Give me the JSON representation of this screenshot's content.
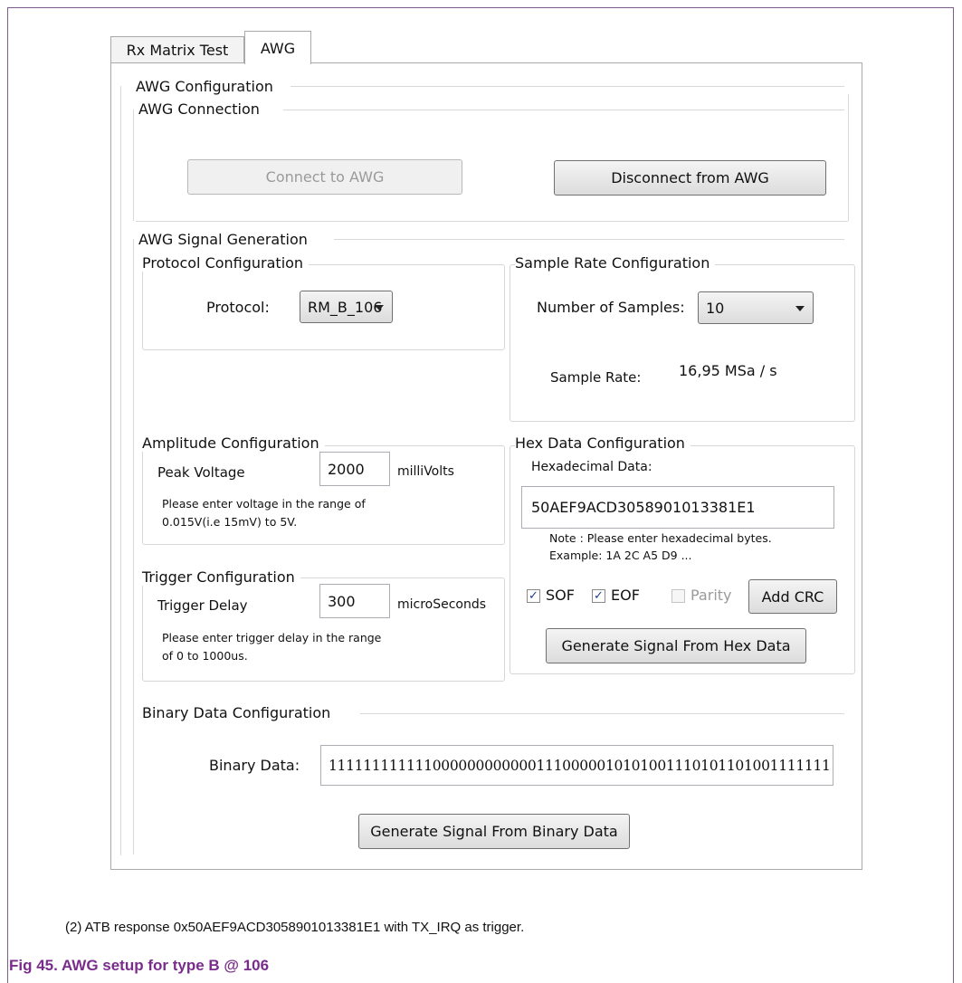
{
  "tabs": [
    {
      "label": "Rx Matrix Test"
    },
    {
      "label": "AWG"
    }
  ],
  "awg_config": {
    "title": "AWG Configuration",
    "connection": {
      "title": "AWG Connection",
      "connect_label": "Connect to AWG",
      "disconnect_label": "Disconnect from AWG"
    },
    "signal_generation": {
      "title": "AWG Signal Generation",
      "protocol": {
        "title": "Protocol Configuration",
        "label": "Protocol:",
        "value": "RM_B_106"
      },
      "sample_rate": {
        "title": "Sample Rate Configuration",
        "num_samples_label": "Number of Samples:",
        "num_samples_value": "10",
        "rate_label": "Sample Rate:",
        "rate_value": "16,95 MSa / s"
      },
      "amplitude": {
        "title": "Amplitude Configuration",
        "label": "Peak Voltage",
        "value": "2000",
        "unit": "milliVolts",
        "note": "Please enter voltage in the range of 0.015V(i.e 15mV) to 5V."
      },
      "trigger": {
        "title": "Trigger Configuration",
        "label": "Trigger Delay",
        "value": "300",
        "unit": "microSeconds",
        "note": "Please enter trigger delay in the range of 0 to 1000us."
      },
      "hex": {
        "title": "Hex Data Configuration",
        "label": "Hexadecimal Data:",
        "value": "50AEF9ACD3058901013381E1",
        "note_line1": "Note : Please enter hexadecimal bytes.",
        "note_line2": "Example: 1A 2C A5 D9 ...",
        "sof_label": "SOF",
        "sof_checked": true,
        "eof_label": "EOF",
        "eof_checked": true,
        "parity_label": "Parity",
        "parity_checked": false,
        "add_crc_label": "Add CRC",
        "generate_label": "Generate Signal From Hex Data"
      },
      "binary": {
        "title": "Binary Data Configuration",
        "label": "Binary Data:",
        "value": "1111111111110000000000001110000010101001110101101001111111",
        "generate_label": "Generate Signal From Binary Data"
      }
    }
  },
  "caption": {
    "note": "(2)   ATB response 0x50AEF9ACD3058901013381E1 with TX_IRQ as trigger.",
    "fig_title": "Fig 45. AWG setup for type B @ 106",
    "fig_color": "#7a2c8c"
  }
}
